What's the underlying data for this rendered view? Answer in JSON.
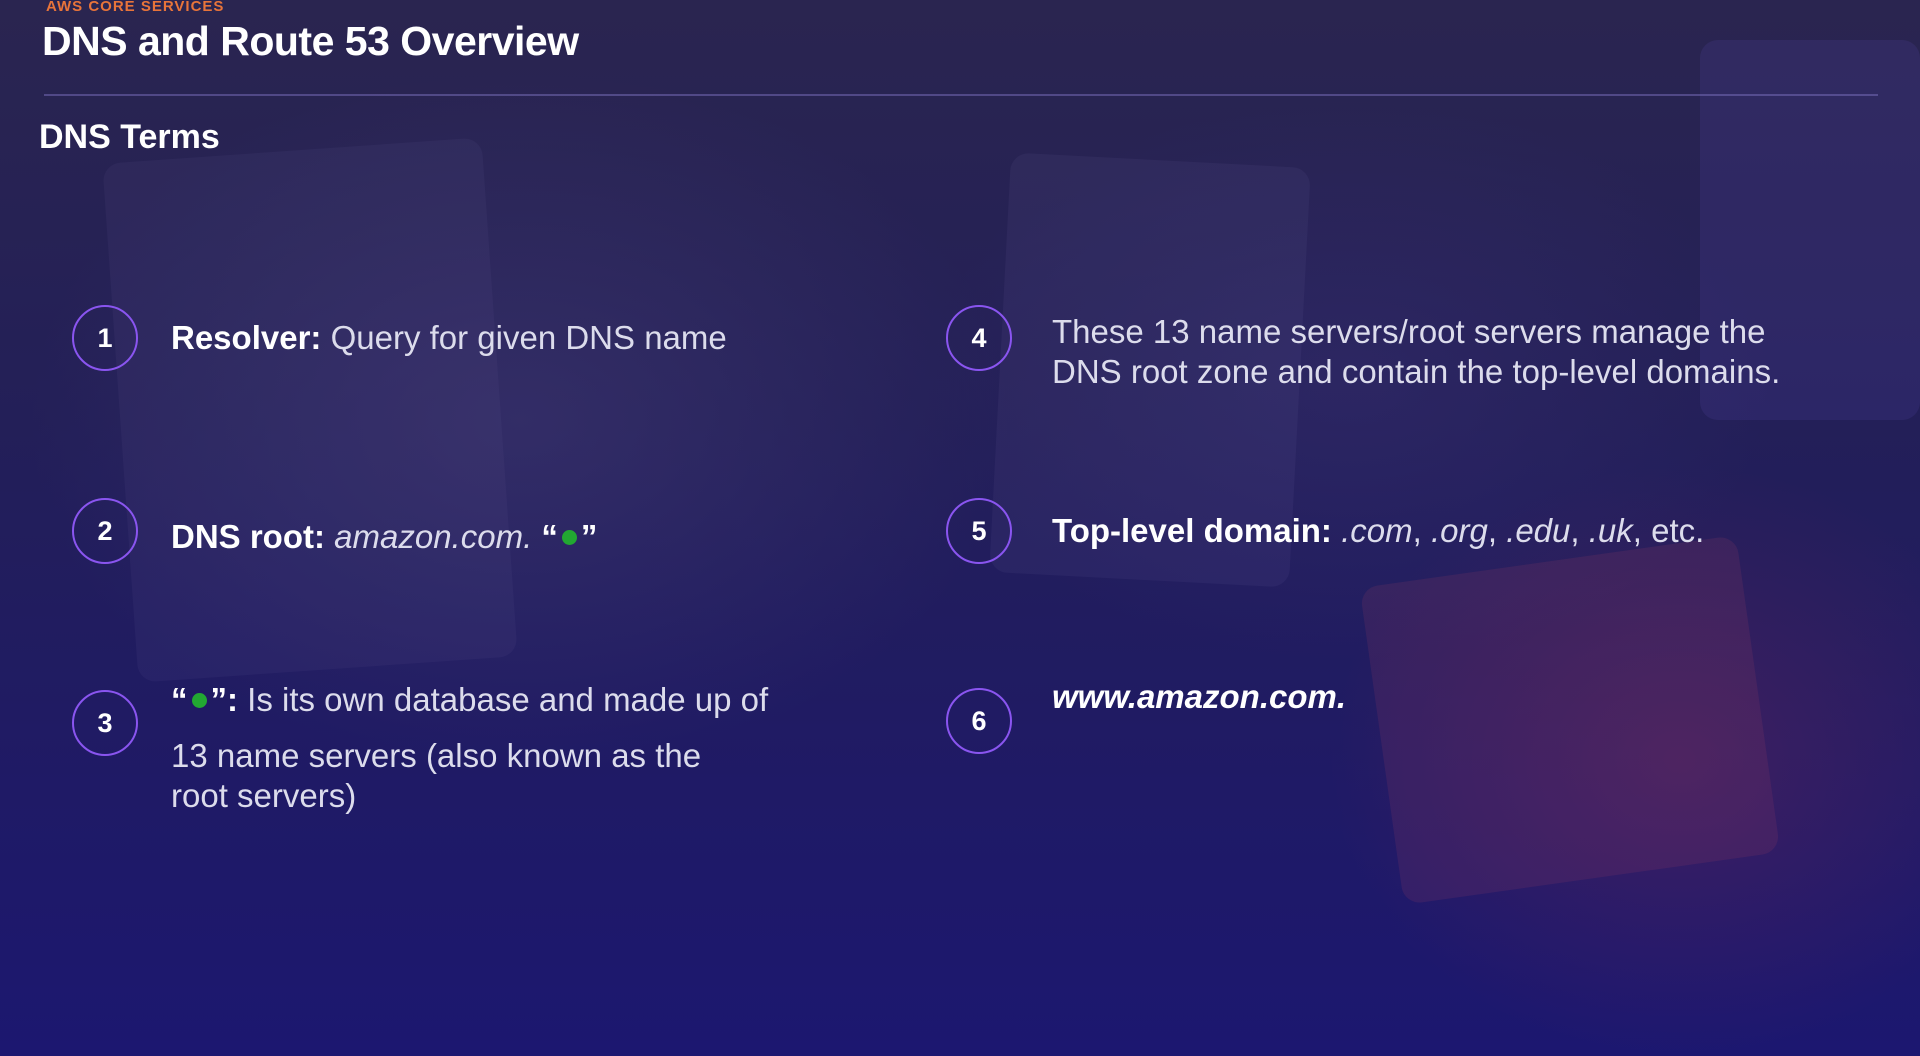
{
  "header": {
    "section_label": "AWS CORE SERVICES",
    "title": "DNS and Route 53 Overview",
    "subtitle": "DNS Terms"
  },
  "terms": [
    {
      "number": "1",
      "label": "Resolver:",
      "text": "Query for given DNS name"
    },
    {
      "number": "2",
      "label": "DNS root:",
      "example": "amazon.com.",
      "open_quote": "“",
      "close_quote": "”"
    },
    {
      "number": "3",
      "open_quote": "“",
      "close_label": "”:",
      "text": "Is its own database and made up of",
      "text_line2": "13 name servers (also known as the root servers)"
    },
    {
      "number": "4",
      "text": "These 13 name servers/root servers manage the DNS root zone and contain the top-level domains."
    },
    {
      "number": "5",
      "label": "Top-level domain:",
      "tlds": [
        ".com",
        ".org",
        ".edu",
        ".uk"
      ],
      "separator": ",",
      "suffix": "etc."
    },
    {
      "number": "6",
      "text": "www.amazon.com."
    }
  ],
  "colors": {
    "accent_orange": "#e8743a",
    "badge_border": "#8a55f0",
    "root_dot": "#22a832"
  },
  "icons": {
    "root_dot": "green-dot-icon"
  }
}
